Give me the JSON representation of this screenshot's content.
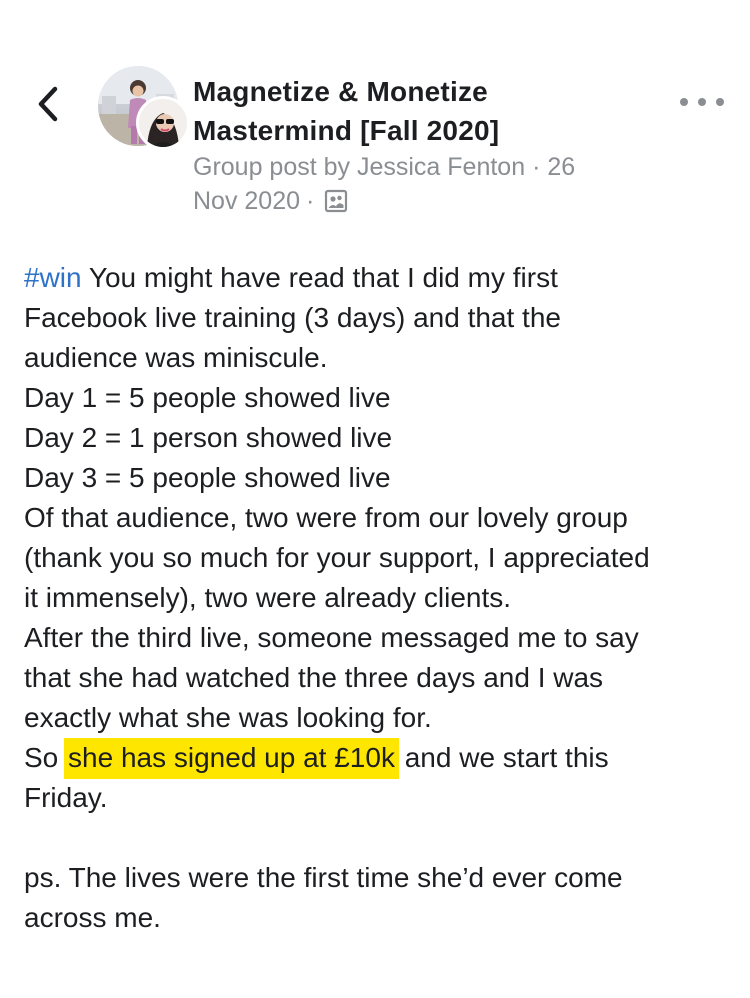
{
  "header": {
    "back_icon": "chevron-left-icon",
    "group_name_line1": "Magnetize & Monetize",
    "group_name_line2": "Mastermind [Fall 2020]",
    "meta_line1": "Group post by Jessica Fenton · 26",
    "meta_date": "Nov 2020",
    "meta_dot": "·",
    "privacy_icon": "group-privacy-icon",
    "more_icon": "more-options-icon"
  },
  "post": {
    "hashtag": "#win",
    "line1_rest": " You might have read that I did my first",
    "line2": "Facebook live training (3 days) and that the",
    "line3": "audience was miniscule.",
    "line4": "Day 1 = 5 people showed live",
    "line5": "Day 2 = 1 person showed live",
    "line6": "Day 3 = 5 people showed live",
    "line7": "Of that audience, two were from our lovely group",
    "line8": "(thank you so much for your support, I appreciated",
    "line9": "it immensely), two were already clients.",
    "line10": "After the third live, someone messaged me to say",
    "line11": "that she had watched the three days and I was",
    "line12": "exactly what she was looking for.",
    "line13_pre": "So ",
    "line13_highlight": "she has signed up at £10k",
    "line13_post": " and we start this",
    "line14": "Friday.",
    "line16": "ps. The lives were the first time she’d ever come",
    "line17": "across me."
  },
  "colors": {
    "hashtag": "#2e72c8",
    "highlight": "#ffe600",
    "meta_text": "#8a8d91",
    "body_text": "#1c1e21"
  }
}
